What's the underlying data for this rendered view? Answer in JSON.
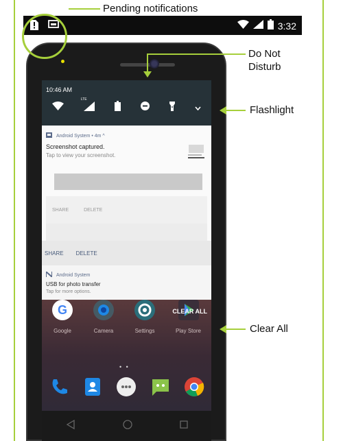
{
  "callouts": {
    "pending": "Pending notifications",
    "dnd_line1": "Do Not",
    "dnd_line2": "Disturb",
    "flashlight": "Flashlight",
    "clear_all": "Clear All"
  },
  "status_bar": {
    "time": "3:32",
    "left_icons": [
      "sim-alert-icon",
      "cast-icon"
    ],
    "right_icons": [
      "wifi-icon",
      "lte-signal-icon",
      "battery-icon"
    ]
  },
  "quick_settings": {
    "time": "10:46 AM",
    "tiles": [
      "wifi-icon",
      "lte-signal-icon",
      "battery-icon",
      "do-not-disturb-icon",
      "flashlight-icon",
      "expand-chevron-icon"
    ],
    "lte_badge": "LTE"
  },
  "notification_screenshot": {
    "app": "Android System • 4m ^",
    "title": "Screenshot captured.",
    "text": "Tap to view your screenshot.",
    "inner_share": "SHARE",
    "inner_delete": "DELETE"
  },
  "actions": {
    "share": "SHARE",
    "delete": "DELETE"
  },
  "notification_usb": {
    "app": "Android System",
    "title": "USB for photo transfer",
    "text": "Tap for more options."
  },
  "home": {
    "clear_all": "CLEAR ALL",
    "apps": [
      {
        "label": "Google",
        "icon": "google-icon"
      },
      {
        "label": "Camera",
        "icon": "camera-icon"
      },
      {
        "label": "Settings",
        "icon": "settings-icon"
      },
      {
        "label": "Play Store",
        "icon": "play-store-icon"
      }
    ],
    "dock": [
      "phone-icon",
      "contacts-icon",
      "app-drawer-icon",
      "messages-icon",
      "chrome-icon"
    ],
    "page_dots": "• •"
  },
  "colors": {
    "accent": "#a6cf3b",
    "qs_bg": "#263238",
    "action_text": "#475a7a"
  }
}
